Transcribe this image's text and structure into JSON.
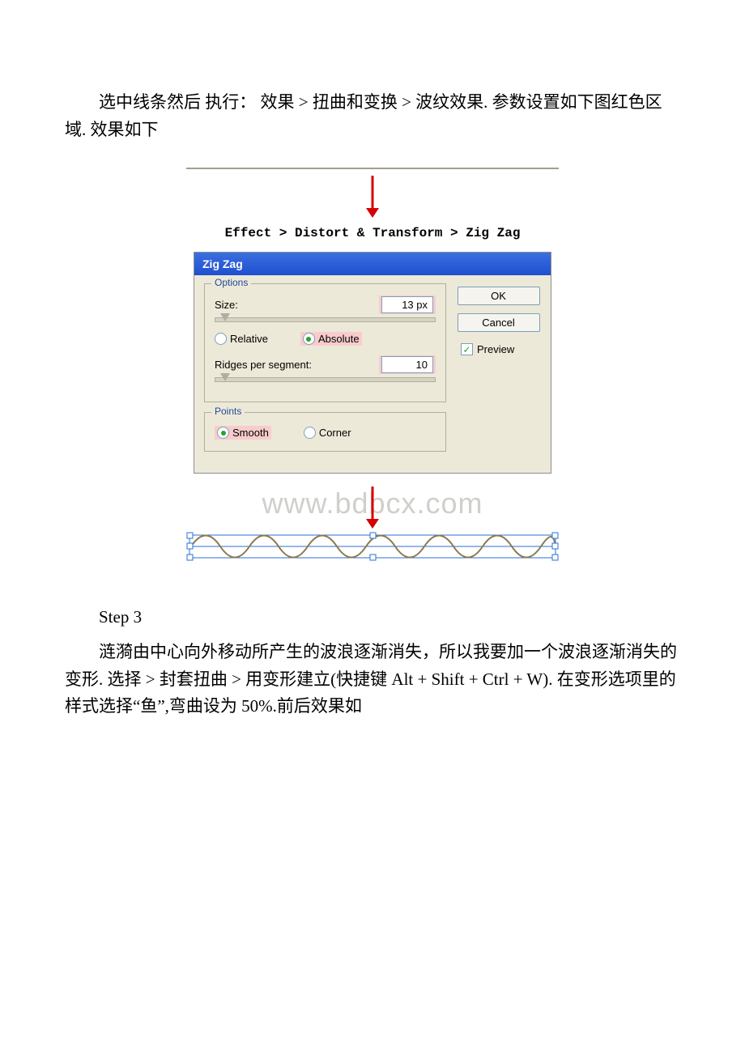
{
  "body": {
    "paragraph1": "选中线条然后 执行：  效果 > 扭曲和变换 > 波纹效果. 参数设置如下图红色区域. 效果如下",
    "step3_heading": "Step 3",
    "paragraph2": "涟漪由中心向外移动所产生的波浪逐渐消失，所以我要加一个波浪逐渐消失的变形. 选择 > 封套扭曲 > 用变形建立(快捷键 Alt + Shift + Ctrl + W). 在变形选项里的样式选择“鱼”,弯曲设为 50%.前后效果如"
  },
  "figure": {
    "menu_path": "Effect > Distort & Transform > Zig Zag",
    "watermark": "www.bdbcx.com",
    "dialog": {
      "title": "Zig Zag",
      "options_group": "Options",
      "size_label": "Size:",
      "size_value": "13 px",
      "relative_label": "Relative",
      "absolute_label": "Absolute",
      "ridges_label": "Ridges per segment:",
      "ridges_value": "10",
      "points_group": "Points",
      "smooth_label": "Smooth",
      "corner_label": "Corner",
      "ok": "OK",
      "cancel": "Cancel",
      "preview": "Preview"
    }
  }
}
